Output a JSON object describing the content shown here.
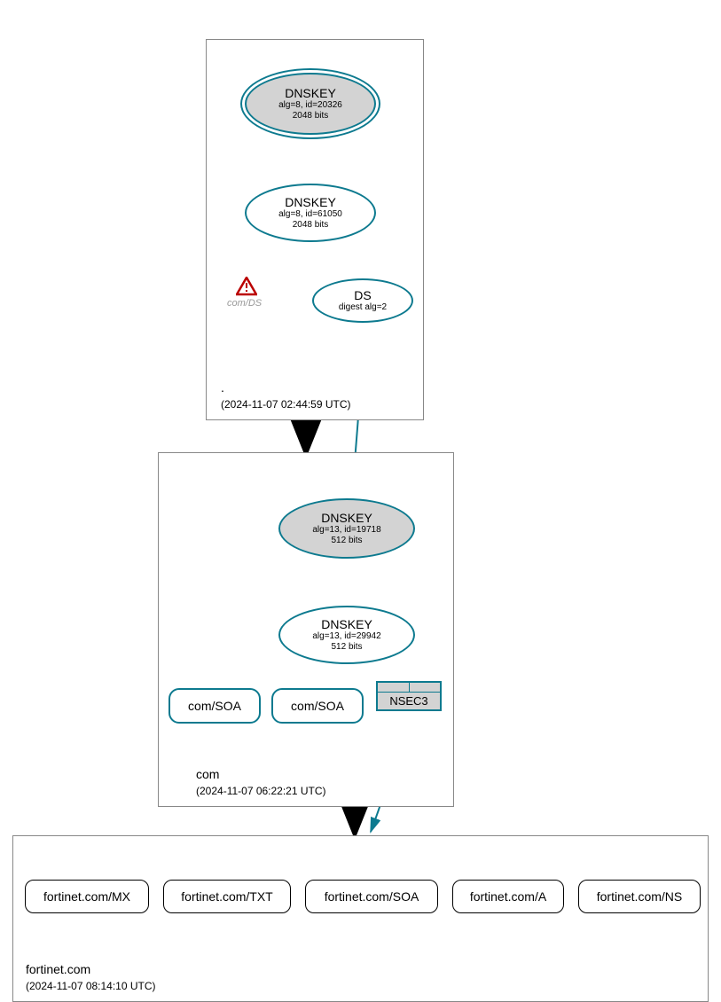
{
  "zones": {
    "root": {
      "name": ".",
      "timestamp": "(2024-11-07 02:44:59 UTC)",
      "dnskey_ksk": {
        "title": "DNSKEY",
        "line1": "alg=8, id=20326",
        "line2": "2048 bits"
      },
      "dnskey_zsk": {
        "title": "DNSKEY",
        "line1": "alg=8, id=61050",
        "line2": "2048 bits"
      },
      "ds": {
        "title": "DS",
        "line1": "digest alg=2"
      },
      "warning_label": "com/DS"
    },
    "com": {
      "name": "com",
      "timestamp": "(2024-11-07 06:22:21 UTC)",
      "dnskey_ksk": {
        "title": "DNSKEY",
        "line1": "alg=13, id=19718",
        "line2": "512 bits"
      },
      "dnskey_zsk": {
        "title": "DNSKEY",
        "line1": "alg=13, id=29942",
        "line2": "512 bits"
      },
      "soa1": "com/SOA",
      "soa2": "com/SOA",
      "nsec3": "NSEC3"
    },
    "fortinet": {
      "name": "fortinet.com",
      "timestamp": "(2024-11-07 08:14:10 UTC)",
      "records": {
        "mx": "fortinet.com/MX",
        "txt": "fortinet.com/TXT",
        "soa": "fortinet.com/SOA",
        "a": "fortinet.com/A",
        "ns": "fortinet.com/NS"
      }
    }
  }
}
